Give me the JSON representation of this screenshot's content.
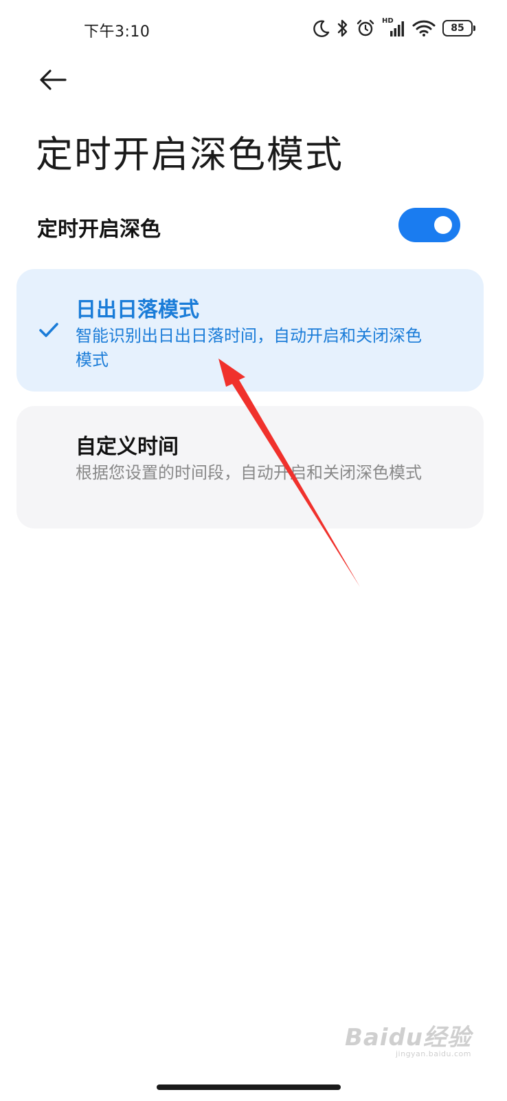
{
  "status_bar": {
    "time": "下午3:10",
    "icons": [
      "moon-icon",
      "bluetooth-icon",
      "alarm-icon",
      "hd-signal-icon",
      "wifi-icon",
      "battery-icon"
    ],
    "hd_label": "HD",
    "battery_level": "85"
  },
  "header": {
    "back_icon": "arrow-left-icon",
    "title": "定时开启深色模式"
  },
  "toggle": {
    "label": "定时开启深色",
    "enabled": true
  },
  "options": [
    {
      "title": "日出日落模式",
      "description": "智能识别出日出日落时间，自动开启和关闭深色模式",
      "selected": true
    },
    {
      "title": "自定义时间",
      "description": "根据您设置的时间段，自动开启和关闭深色模式",
      "selected": false
    }
  ],
  "watermark": {
    "logo_text": "Baidu经验",
    "url": "jingyan.baidu.com"
  },
  "colors": {
    "accent": "#1a7cf0",
    "selected_card_bg": "#e6f1fd",
    "unselected_card_bg": "#f5f5f7",
    "annotation_arrow": "#f0312c"
  }
}
